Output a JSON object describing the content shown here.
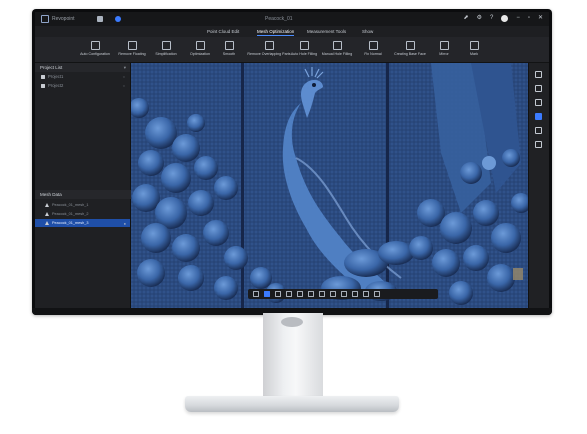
{
  "app": {
    "logo_text": "Revopoint",
    "title": "Peacock_01"
  },
  "menu_tabs": [
    {
      "label": "Point Cloud Edit",
      "active": false
    },
    {
      "label": "Mesh Optimization",
      "active": true
    },
    {
      "label": "Measurement Tools",
      "active": false
    },
    {
      "label": "Show",
      "active": false
    }
  ],
  "toolbar": [
    {
      "label": "Auto Configuration",
      "icon": "gear-icon"
    },
    {
      "label": "Remove Floating",
      "icon": "eye-icon"
    },
    {
      "label": "Simplification",
      "icon": "sliders-icon"
    },
    {
      "label": "Optimization",
      "icon": "grid-icon"
    },
    {
      "label": "Smooth",
      "icon": "wave-icon"
    },
    {
      "label": "Remove Overlapping Parts",
      "icon": "refresh-icon"
    },
    {
      "label": "Auto Hole Filling",
      "icon": "fill-icon"
    },
    {
      "label": "Manual Hole Filling",
      "icon": "brush-icon"
    },
    {
      "label": "Fix Normal",
      "icon": "normal-icon"
    },
    {
      "label": "Creating Base Face",
      "icon": "chart-icon"
    },
    {
      "label": "Mirror",
      "icon": "mirror-icon"
    },
    {
      "label": "Mark",
      "icon": "mark-icon"
    }
  ],
  "left_panel": {
    "project_header": "Project List",
    "projects": [
      {
        "label": "Project1",
        "right": "○"
      },
      {
        "label": "Project2",
        "right": "○"
      }
    ],
    "mesh_header": "Mesh Data",
    "meshes": [
      {
        "label": "Peacock_01_mesh_1",
        "selected": false
      },
      {
        "label": "Peacock_01_mesh_2",
        "selected": false
      },
      {
        "label": "Peacock_01_mesh_3",
        "selected": true
      }
    ]
  },
  "colors": {
    "accent": "#3b7bff",
    "mesh_blue": "#3a66a8",
    "bg_dark": "#1b1c1f"
  }
}
